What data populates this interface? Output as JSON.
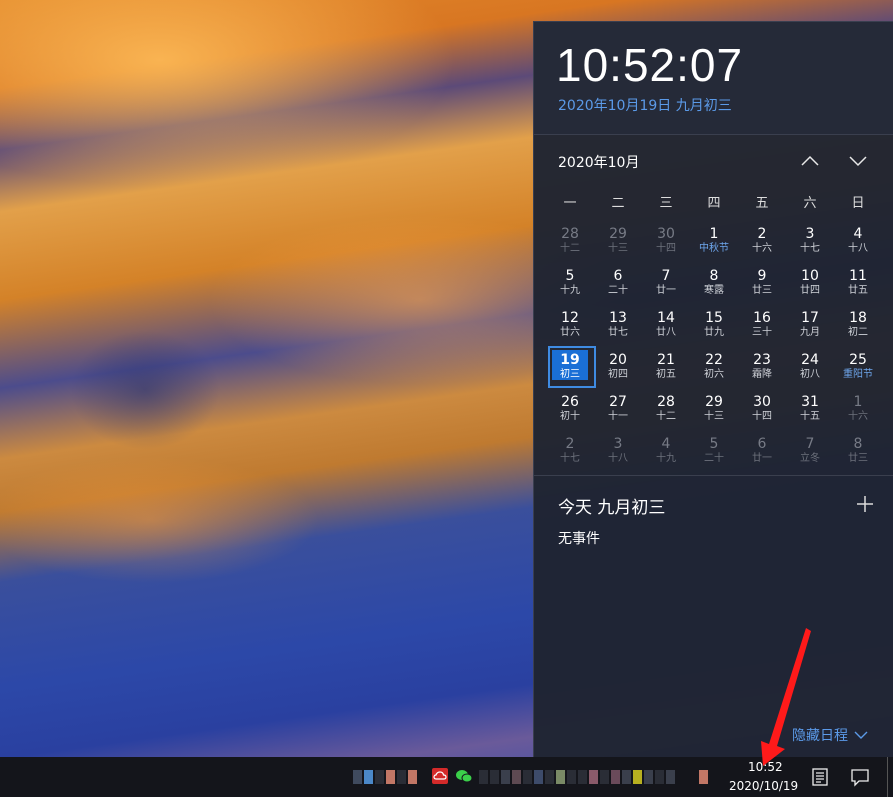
{
  "clock": {
    "time": "10:52:07",
    "full_date": "2020年10月19日 九月初三"
  },
  "calendar": {
    "month_label": "2020年10月",
    "weekdays": [
      "一",
      "二",
      "三",
      "四",
      "五",
      "六",
      "日"
    ],
    "days": [
      {
        "n": "28",
        "l": "十二",
        "dim": true
      },
      {
        "n": "29",
        "l": "十三",
        "dim": true
      },
      {
        "n": "30",
        "l": "十四",
        "dim": true
      },
      {
        "n": "1",
        "l": "中秋节",
        "fest": true
      },
      {
        "n": "2",
        "l": "十六"
      },
      {
        "n": "3",
        "l": "十七"
      },
      {
        "n": "4",
        "l": "十八"
      },
      {
        "n": "5",
        "l": "十九"
      },
      {
        "n": "6",
        "l": "二十"
      },
      {
        "n": "7",
        "l": "廿一"
      },
      {
        "n": "8",
        "l": "寒露"
      },
      {
        "n": "9",
        "l": "廿三"
      },
      {
        "n": "10",
        "l": "廿四"
      },
      {
        "n": "11",
        "l": "廿五"
      },
      {
        "n": "12",
        "l": "廿六"
      },
      {
        "n": "13",
        "l": "廿七"
      },
      {
        "n": "14",
        "l": "廿八"
      },
      {
        "n": "15",
        "l": "廿九"
      },
      {
        "n": "16",
        "l": "三十"
      },
      {
        "n": "17",
        "l": "九月"
      },
      {
        "n": "18",
        "l": "初二"
      },
      {
        "n": "19",
        "l": "初三",
        "today": true
      },
      {
        "n": "20",
        "l": "初四"
      },
      {
        "n": "21",
        "l": "初五"
      },
      {
        "n": "22",
        "l": "初六"
      },
      {
        "n": "23",
        "l": "霜降"
      },
      {
        "n": "24",
        "l": "初八"
      },
      {
        "n": "25",
        "l": "重阳节",
        "fest": true
      },
      {
        "n": "26",
        "l": "初十"
      },
      {
        "n": "27",
        "l": "十一"
      },
      {
        "n": "28",
        "l": "十二"
      },
      {
        "n": "29",
        "l": "十三"
      },
      {
        "n": "30",
        "l": "十四"
      },
      {
        "n": "31",
        "l": "十五"
      },
      {
        "n": "1",
        "l": "十六",
        "dim": true
      },
      {
        "n": "2",
        "l": "十七",
        "dim": true
      },
      {
        "n": "3",
        "l": "十八",
        "dim": true
      },
      {
        "n": "4",
        "l": "十九",
        "dim": true
      },
      {
        "n": "5",
        "l": "二十",
        "dim": true
      },
      {
        "n": "6",
        "l": "廿一",
        "dim": true
      },
      {
        "n": "7",
        "l": "立冬",
        "dim": true
      },
      {
        "n": "8",
        "l": "廿三",
        "dim": true
      }
    ]
  },
  "agenda": {
    "title": "今天 九月初三",
    "empty_text": "无事件",
    "hide_label": "隐藏日程"
  },
  "taskbar": {
    "time": "10:52",
    "date": "2020/10/19"
  },
  "colors": {
    "accent": "#1a6fd6",
    "link": "#5b9ae8",
    "annotation_arrow": "#ff1a1a"
  },
  "icons": {
    "calendar_prev": "chevron-up-icon",
    "calendar_next": "chevron-down-icon",
    "add_event": "plus-icon",
    "hide_agenda": "chevron-down-icon",
    "tray_cloud": "baidu-cloud-icon",
    "tray_wechat": "wechat-icon",
    "notes": "notes-icon",
    "action_center": "action-center-icon"
  }
}
